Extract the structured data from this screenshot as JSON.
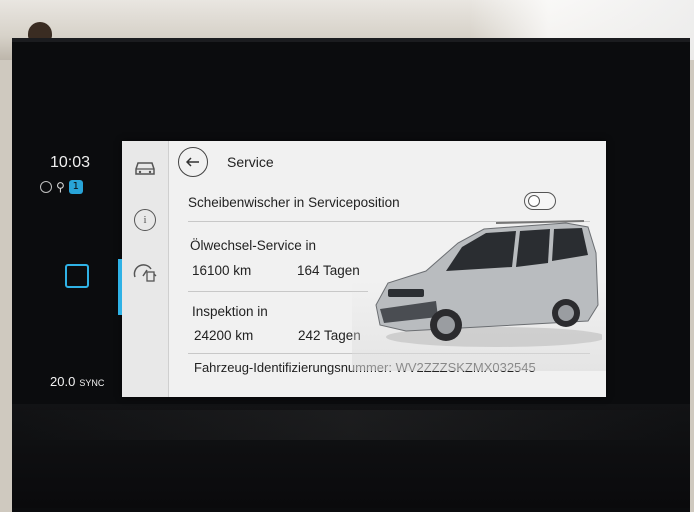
{
  "status": {
    "time": "10:03",
    "badge_count": "1",
    "temperature": "20.0",
    "sync_label": "SYNC"
  },
  "header": {
    "title": "Service",
    "back_icon": "back-arrow-icon"
  },
  "rail": {
    "items": [
      {
        "icon": "car-icon"
      },
      {
        "icon": "info-icon",
        "glyph": "i",
        "active": true
      },
      {
        "icon": "service-gauge-icon"
      }
    ]
  },
  "settings": {
    "wiper_label": "Scheibenwischer in Serviceposition",
    "wiper_toggle": "off",
    "oil_label": "Ölwechsel-Service in",
    "oil_km": "16100 km",
    "oil_days": "164 Tagen",
    "inspection_label": "Inspektion in",
    "inspection_km": "24200 km",
    "inspection_days": "242 Tagen",
    "vin_text": "Fahrzeug-Identifizierungsnummer: WV2ZZZSKZMX032545"
  },
  "colors": {
    "accent": "#2fb2e6",
    "screen_bg": "#f1f1f1",
    "bezel": "#0b0c0e"
  }
}
